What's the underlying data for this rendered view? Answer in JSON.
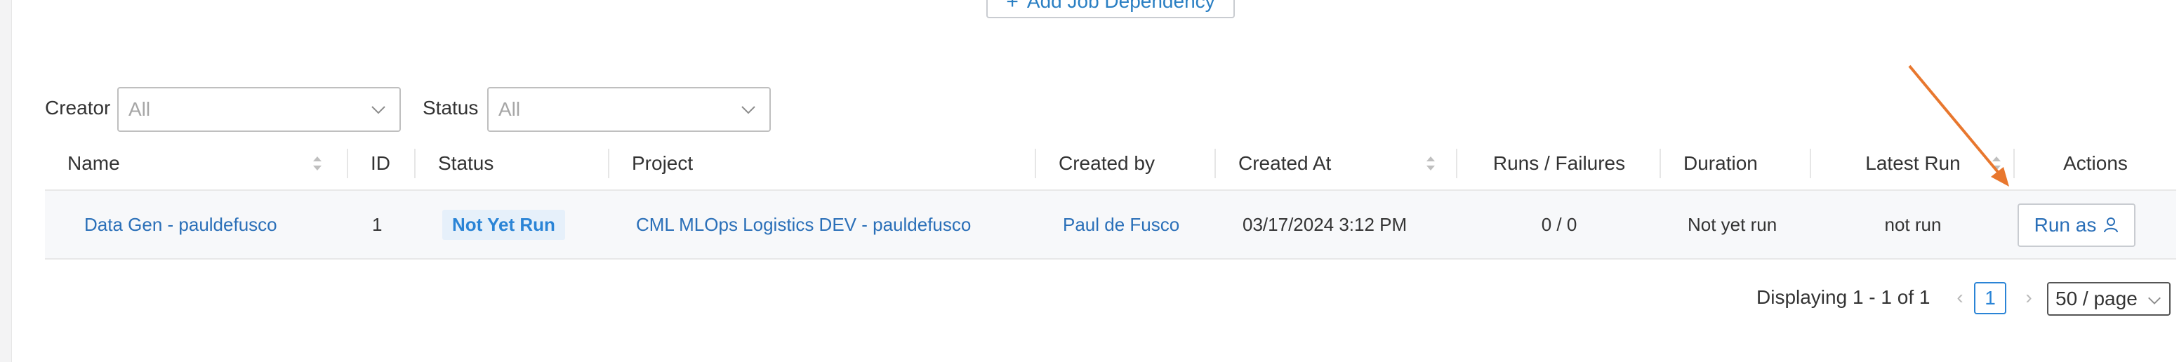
{
  "toolbar": {
    "add_dependency_label": "Add Job Dependency"
  },
  "filters": {
    "creator_label": "Creator",
    "creator_value": "All",
    "status_label": "Status",
    "status_value": "All"
  },
  "table": {
    "columns": {
      "name": "Name",
      "id": "ID",
      "status": "Status",
      "project": "Project",
      "created_by": "Created by",
      "created_at": "Created At",
      "runs_failures": "Runs / Failures",
      "duration": "Duration",
      "latest_run": "Latest Run",
      "actions": "Actions"
    },
    "rows": [
      {
        "name": "Data Gen - pauldefusco",
        "id": "1",
        "status": "Not Yet Run",
        "project": "CML MLOps Logistics DEV - pauldefusco",
        "created_by": "Paul de Fusco",
        "created_at": "03/17/2024 3:12 PM",
        "runs_failures": "0 / 0",
        "duration": "Not yet run",
        "latest_run": "not run",
        "action_label": "Run as"
      }
    ]
  },
  "pagination": {
    "summary": "Displaying 1 - 1 of 1",
    "current_page": "1",
    "page_size": "50 / page"
  },
  "icons": {
    "sort": "sort-icon",
    "dropdown": "chevron-down-icon",
    "user": "user-icon",
    "prev": "chevron-left-icon",
    "next": "chevron-right-icon"
  },
  "colors": {
    "link": "#2a6fb8",
    "badge_bg": "#e6f0fa",
    "badge_text": "#2a84d6",
    "annotation_arrow": "#e8772e"
  }
}
